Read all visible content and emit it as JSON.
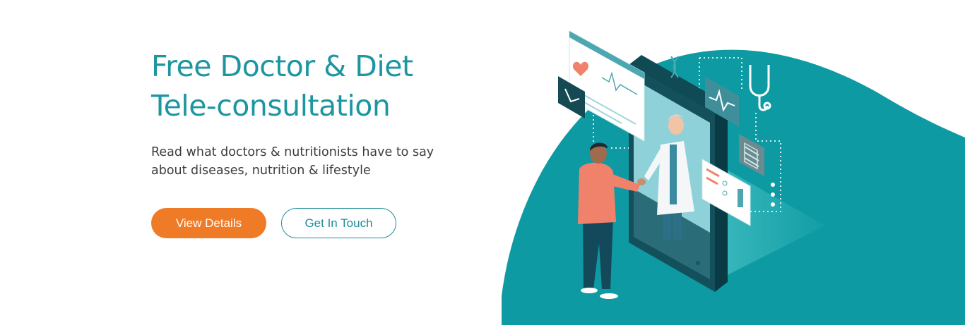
{
  "hero": {
    "title_line1": "Free Doctor & Diet",
    "title_line2": "Tele-consultation",
    "subtitle_line1": "Read what doctors & nutritionists have to say",
    "subtitle_line2": "about diseases, nutrition & lifestyle"
  },
  "buttons": {
    "primary_label": "View Details",
    "secondary_label": "Get In Touch"
  },
  "illustration": {
    "icons": [
      "heart-monitor-icon",
      "chart-icon",
      "ecg-icon",
      "stethoscope-icon",
      "dna-icon",
      "document-icon",
      "report-icon"
    ],
    "people": [
      "patient",
      "doctor"
    ]
  },
  "colors": {
    "brand_teal": "#1d96a0",
    "blob_teal": "#0e9aa3",
    "accent_orange": "#f07b27",
    "text_dark": "#3d3d3d"
  }
}
